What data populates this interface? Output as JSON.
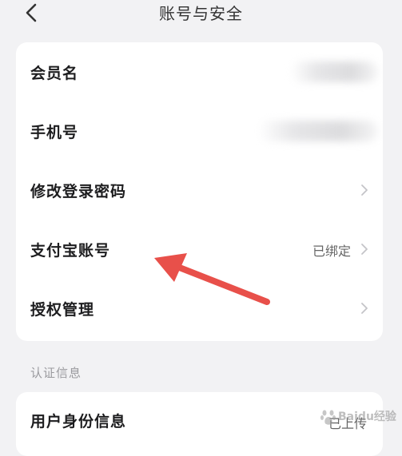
{
  "header": {
    "title": "账号与安全",
    "back_icon": "chevron-left-icon"
  },
  "account_card": {
    "rows": [
      {
        "label": "会员名",
        "value": ""
      },
      {
        "label": "手机号",
        "value": ""
      },
      {
        "label": "修改登录密码",
        "value": ""
      },
      {
        "label": "支付宝账号",
        "value": "已绑定"
      },
      {
        "label": "授权管理",
        "value": ""
      }
    ]
  },
  "verification_section": {
    "title": "认证信息",
    "rows": [
      {
        "label": "用户身份信息",
        "value": "已上传"
      }
    ]
  },
  "annotation": {
    "arrow_color": "#e8504a"
  },
  "watermark": {
    "text": "Baidu经验"
  }
}
